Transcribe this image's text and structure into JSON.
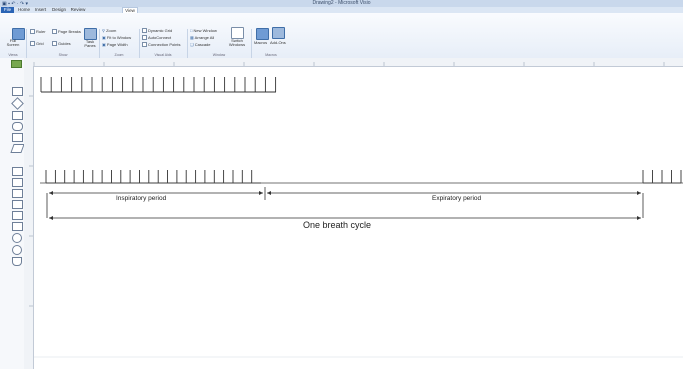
{
  "app": {
    "window_title": "Drawing2 - Microsoft Visio",
    "quick_access": "▣ ▪ ↶ · ↷ ▾"
  },
  "tabs": [
    "File",
    "Home",
    "Insert",
    "Design",
    "Review",
    "View"
  ],
  "active_tab": "View",
  "ribbon": {
    "full_screen": "Full Screen",
    "views_group": "Views",
    "ruler": "Ruler",
    "page_breaks": "Page Breaks",
    "grid": "Grid",
    "guides": "Guides",
    "show_group": "Show",
    "task_panes": "Task Panes",
    "zoom": "Zoom",
    "fit_to_window": "Fit to Window",
    "page_width": "Page Width",
    "zoom_group": "Zoom",
    "dynamic_grid": "Dynamic Grid",
    "autoconnect": "AutoConnect",
    "connection_points": "Connection Points",
    "visual_aids_group": "Visual Aids",
    "new_window": "New Window",
    "arrange_all": "Arrange All",
    "cascade": "Cascade",
    "switch_windows": "Switch Windows",
    "window_group": "Window",
    "macros": "Macros",
    "add_ons": "Add-Ons",
    "macros_group": "Macros"
  },
  "diagram": {
    "inspiratory": "Inspiratory period",
    "expiratory": "Expiratory period",
    "cycle": "One breath cycle"
  },
  "colors": {
    "accent": "#2a64b5",
    "ribbon": "#e7eef8",
    "tick": "#333333"
  }
}
